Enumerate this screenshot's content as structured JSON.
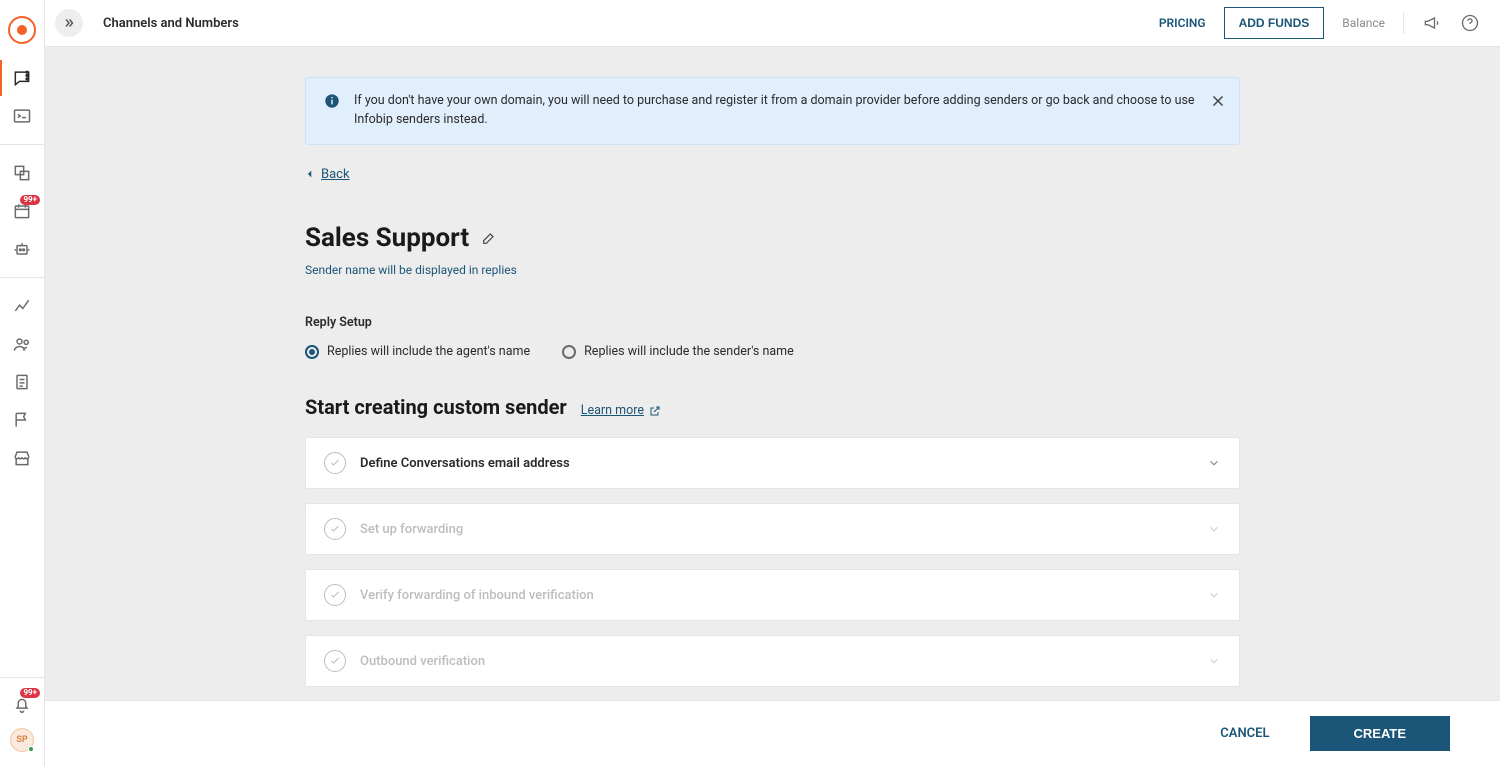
{
  "topbar": {
    "title": "Channels and Numbers",
    "pricing": "PRICING",
    "add_funds": "ADD FUNDS",
    "balance": "Balance"
  },
  "rail": {
    "badge_count": "99+",
    "bell_badge": "99+",
    "avatar_initials": "SP"
  },
  "banner": {
    "text": "If you don't have your own domain, you will need to purchase and register it from a domain provider before adding senders or go back and choose to use Infobip senders instead."
  },
  "back": "Back",
  "page": {
    "title": "Sales Support",
    "subtitle": "Sender name will be displayed in replies"
  },
  "reply_setup": {
    "label": "Reply Setup",
    "opt_agent": "Replies will include the agent's name",
    "opt_sender": "Replies will include the sender's name"
  },
  "custom_sender": {
    "heading": "Start creating custom sender",
    "learn_more": "Learn more"
  },
  "steps": [
    {
      "label": "Define Conversations email address",
      "active": true
    },
    {
      "label": "Set up forwarding",
      "active": false
    },
    {
      "label": "Verify forwarding of inbound verification",
      "active": false
    },
    {
      "label": "Outbound verification",
      "active": false
    }
  ],
  "footer": {
    "cancel": "CANCEL",
    "create": "CREATE"
  }
}
